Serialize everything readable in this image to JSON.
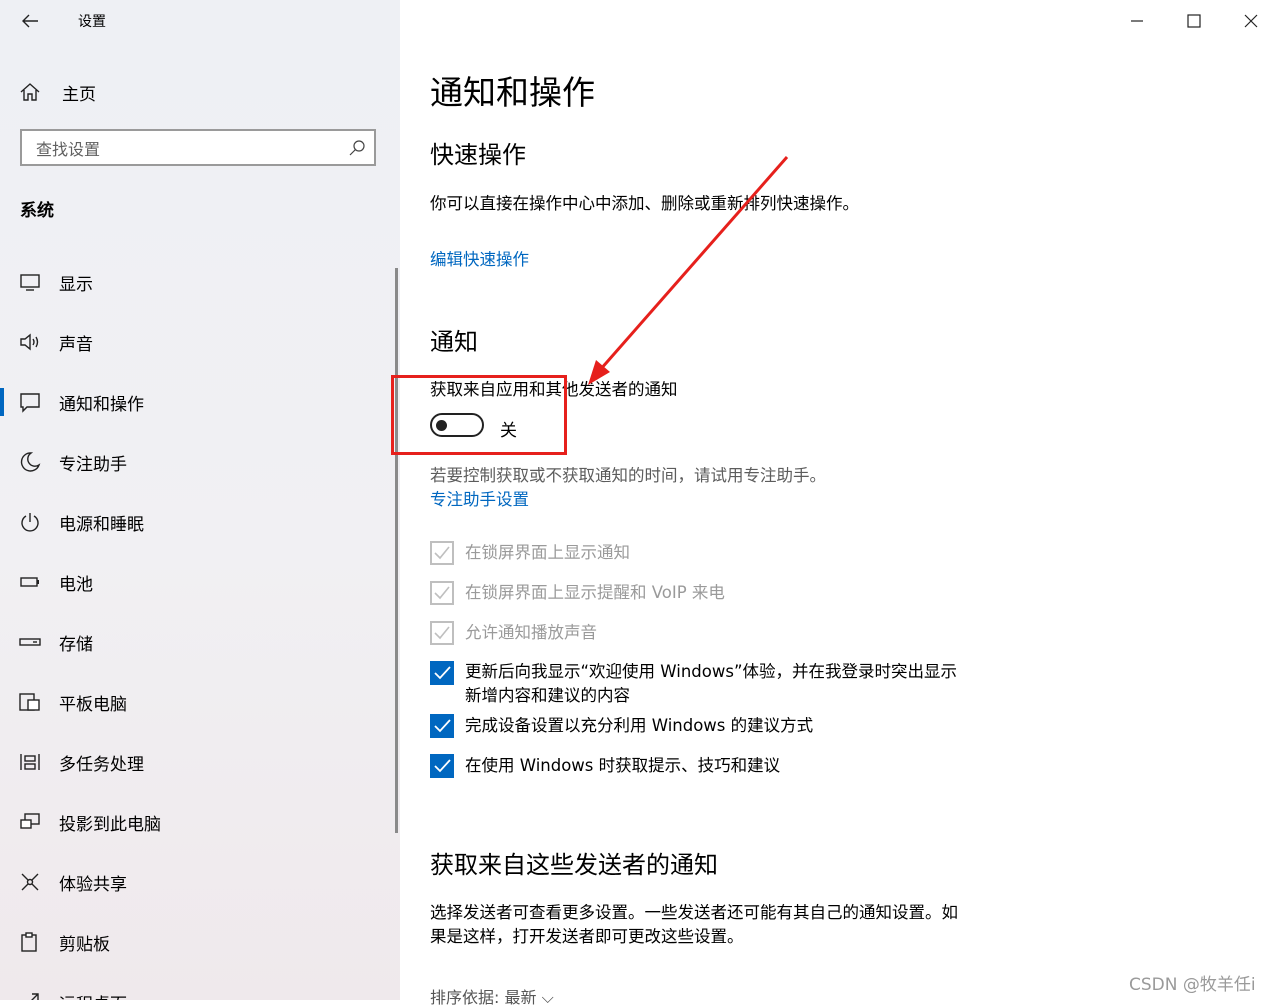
{
  "window": {
    "title": "设置"
  },
  "sidebar": {
    "home_label": "主页",
    "search_placeholder": "查找设置",
    "section_title": "系统",
    "items": [
      {
        "label": "显示",
        "icon": "display-icon"
      },
      {
        "label": "声音",
        "icon": "sound-icon"
      },
      {
        "label": "通知和操作",
        "icon": "notification-icon",
        "selected": true
      },
      {
        "label": "专注助手",
        "icon": "moon-icon"
      },
      {
        "label": "电源和睡眠",
        "icon": "power-icon"
      },
      {
        "label": "电池",
        "icon": "battery-icon"
      },
      {
        "label": "存储",
        "icon": "storage-icon"
      },
      {
        "label": "平板电脑",
        "icon": "tablet-icon"
      },
      {
        "label": "多任务处理",
        "icon": "multitasking-icon"
      },
      {
        "label": "投影到此电脑",
        "icon": "project-icon"
      },
      {
        "label": "体验共享",
        "icon": "share-icon"
      },
      {
        "label": "剪贴板",
        "icon": "clipboard-icon"
      },
      {
        "label": "远程桌面",
        "icon": "remote-desktop-icon"
      }
    ]
  },
  "main": {
    "page_title": "通知和操作",
    "quick_actions": {
      "heading": "快速操作",
      "description": "你可以直接在操作中心中添加、删除或重新排列快速操作。",
      "edit_link": "编辑快速操作"
    },
    "notifications": {
      "heading": "通知",
      "toggle_title": "获取来自应用和其他发送者的通知",
      "toggle_state": "关",
      "toggle_on": false,
      "hint": "若要控制获取或不获取通知的时间，请试用专注助手。",
      "focus_link": "专注助手设置",
      "options": [
        {
          "label": "在锁屏界面上显示通知",
          "checked": true,
          "disabled": true
        },
        {
          "label": "在锁屏界面上显示提醒和 VoIP 来电",
          "checked": true,
          "disabled": true
        },
        {
          "label": "允许通知播放声音",
          "checked": true,
          "disabled": true
        },
        {
          "label": "更新后向我显示“欢迎使用 Windows”体验，并在我登录时突出显示",
          "label2": "新增内容和建议的内容",
          "checked": true,
          "disabled": false
        },
        {
          "label": "完成设备设置以充分利用 Windows 的建议方式",
          "checked": true,
          "disabled": false
        },
        {
          "label": "在使用 Windows 时获取提示、技巧和建议",
          "checked": true,
          "disabled": false
        }
      ]
    },
    "senders": {
      "heading": "获取来自这些发送者的通知",
      "description_line1": "选择发送者可查看更多设置。一些发送者还可能有其自己的通知设置。如",
      "description_line2": "果是这样，打开发送者即可更改这些设置。",
      "sort_label": "排序依据: 最新"
    }
  },
  "annotation": {
    "color": "#e6201c"
  },
  "watermark": "CSDN @牧羊任i",
  "colors": {
    "accent": "#0067c0"
  }
}
